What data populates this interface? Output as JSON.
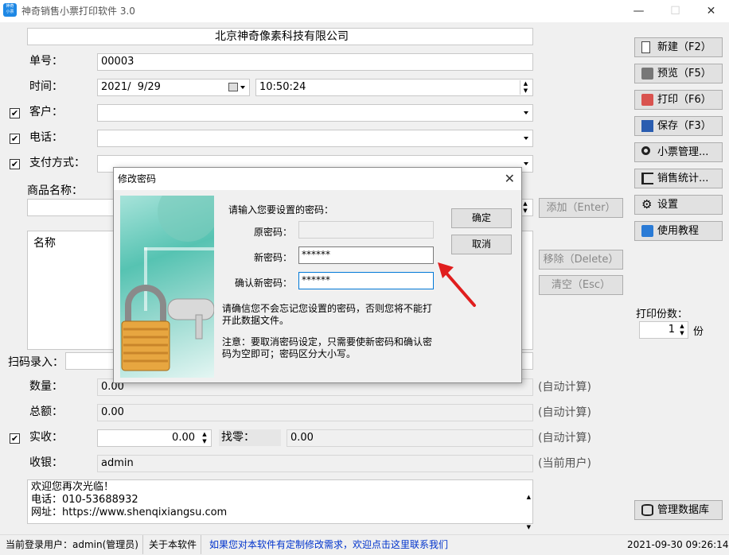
{
  "window": {
    "icon_text": "神奇\n小票",
    "title": "神奇销售小票打印软件 3.0",
    "minimize": "—",
    "maximize": "☐",
    "close": "✕"
  },
  "form": {
    "company": "北京神奇像素科技有限公司",
    "number_label": "单号：",
    "number_value": "00003",
    "time_label": "时间：",
    "date_value": "2021/  9/29",
    "time_value": "10:50:24",
    "customer_label": "客户：",
    "phone_label": "电话：",
    "payment_label": "支付方式：",
    "product_label": "商品名称：",
    "add_button": "添加（Enter）",
    "remove_button": "移除（Delete）",
    "clear_button": "清空（Esc）",
    "list_header_name": "名称",
    "scan_label": "扫码录入：",
    "quantity_label": "数量：",
    "quantity_value": "0.00",
    "total_label": "总额：",
    "total_value": "0.00",
    "received_label": "实收：",
    "received_value": "0.00",
    "change_label": "找零：",
    "change_value": "0.00",
    "cashier_label": "收银：",
    "cashier_value": "admin",
    "auto_calc": "(自动计算)",
    "current_user_note": "(当前用户)",
    "footer_line1": "欢迎您再次光临！",
    "footer_line2": "电话：010-53688932",
    "footer_line3": "网址：https://www.shenqixiangsu.com",
    "check_mark": "✔"
  },
  "sidebar": {
    "new": "新建（F2）",
    "preview": "预览（F5）",
    "print": "打印（F6）",
    "save": "保存（F3）",
    "ticket_manage": "小票管理...",
    "sales_stats": "销售统计...",
    "settings": "设置",
    "tutorial": "使用教程",
    "copies_label": "打印份数：",
    "copies_value": "1",
    "copies_unit": "份",
    "db_manage": "管理数据库"
  },
  "dialog": {
    "title": "修改密码",
    "prompt": "请输入您要设置的密码：",
    "old_label": "原密码：",
    "old_value": "",
    "new_label": "新密码：",
    "new_value": "******",
    "confirm_label": "确认新密码：",
    "confirm_value": "******",
    "ok": "确定",
    "cancel": "取消",
    "warning": "请确信您不会忘记您设置的密码，否则您将不能打开此数据文件。",
    "note": "注意：要取消密码设定，只需要使新密码和确认密码为空即可；密码区分大小写。"
  },
  "status": {
    "user": "当前登录用户：admin(管理员)",
    "about": "关于本软件",
    "custom": "如果您对本软件有定制修改需求，欢迎点击这里联系我们",
    "datetime": "2021-09-30 09:26:14",
    "link_color": "#0033cc"
  }
}
